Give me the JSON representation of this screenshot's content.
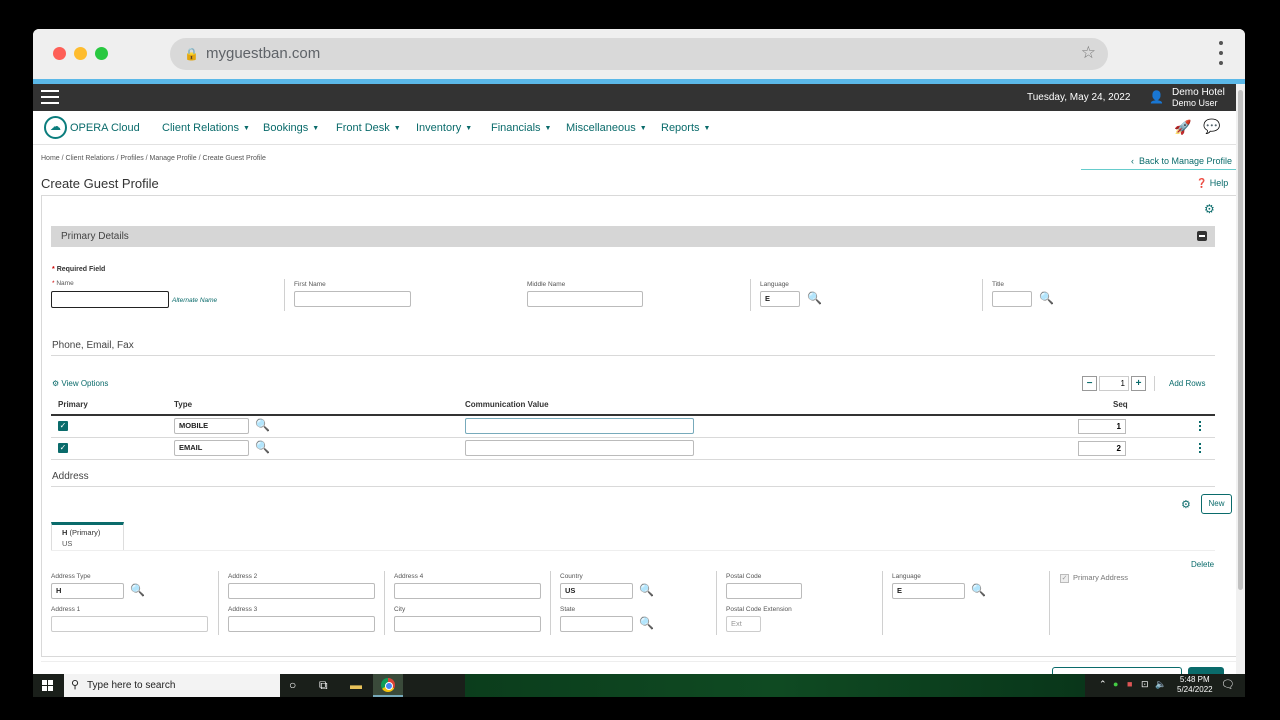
{
  "browser": {
    "url": "myguestban.com"
  },
  "topbar": {
    "date": "Tuesday, May 24, 2022",
    "hotel": "Demo Hotel",
    "user": "Demo User"
  },
  "nav": {
    "brand": "OPERA Cloud",
    "items": [
      {
        "label": "Client Relations"
      },
      {
        "label": "Bookings"
      },
      {
        "label": "Front Desk"
      },
      {
        "label": "Inventory"
      },
      {
        "label": "Financials"
      },
      {
        "label": "Miscellaneous"
      },
      {
        "label": "Reports"
      }
    ]
  },
  "page": {
    "breadcrumb": "Home / Client Relations / Profiles / Manage Profile / Create Guest Profile",
    "back_link": "Back to Manage Profile",
    "title": "Create Guest Profile",
    "help": "Help"
  },
  "primary": {
    "section_title": "Primary Details",
    "required_note": "Required Field",
    "name_label": "Name",
    "name_value": "",
    "alternate_name": "Alternate Name",
    "first_name_label": "First Name",
    "middle_name_label": "Middle Name",
    "language_label": "Language",
    "language_value": "E",
    "title_label": "Title"
  },
  "comm": {
    "section_title": "Phone, Email, Fax",
    "view_options": "View Options",
    "stepper_value": "1",
    "add_rows": "Add Rows",
    "headers": {
      "primary": "Primary",
      "type": "Type",
      "value": "Communication Value",
      "seq": "Seq"
    },
    "rows": [
      {
        "type": "MOBILE",
        "value": "",
        "seq": "1"
      },
      {
        "type": "EMAIL",
        "value": "",
        "seq": "2"
      }
    ]
  },
  "address": {
    "section_title": "Address",
    "new_button": "New",
    "tab_code": "H",
    "tab_primary": "(Primary)",
    "tab_country": "US",
    "delete": "Delete",
    "primary_address": "Primary Address",
    "fields": {
      "address_type_label": "Address Type",
      "address_type_value": "H",
      "address1_label": "Address 1",
      "address2_label": "Address 2",
      "address3_label": "Address 3",
      "address4_label": "Address 4",
      "city_label": "City",
      "country_label": "Country",
      "country_value": "US",
      "state_label": "State",
      "postal_code_label": "Postal Code",
      "postal_ext_label": "Postal Code Extension",
      "postal_ext_placeholder": "Ext",
      "language_label": "Language",
      "language_value": "E"
    }
  },
  "taskbar": {
    "search_placeholder": "Type here to search",
    "time": "5:48 PM",
    "date": "5/24/2022"
  },
  "colors": {
    "accent": "#0a6b6b",
    "topbar": "#333333",
    "section_bar": "#d6d6d6"
  }
}
